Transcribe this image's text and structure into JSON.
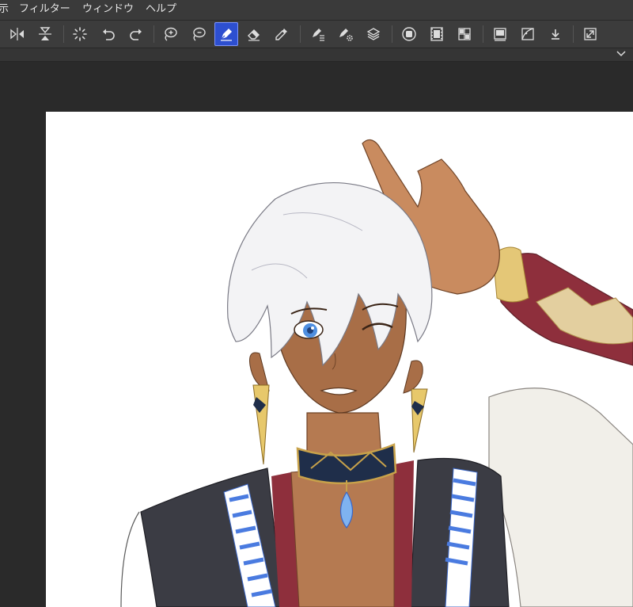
{
  "menu": {
    "items": [
      {
        "label": "示"
      },
      {
        "label": "フィルター"
      },
      {
        "label": "ウィンドウ"
      },
      {
        "label": "ヘルプ"
      }
    ]
  },
  "toolbar": {
    "active_tool": "pen-tool",
    "buttons": [
      {
        "name": "flip-horizontal",
        "icon": "flip-horizontal-icon"
      },
      {
        "name": "flip-vertical",
        "icon": "flip-vertical-icon"
      },
      {
        "name": "loading",
        "icon": "spinner-icon"
      },
      {
        "name": "undo",
        "icon": "undo-icon"
      },
      {
        "name": "redo",
        "icon": "redo-icon"
      },
      {
        "name": "lasso-add",
        "icon": "lasso-add-icon"
      },
      {
        "name": "lasso-subtract",
        "icon": "lasso-subtract-icon"
      },
      {
        "name": "pen-tool",
        "icon": "pen-icon"
      },
      {
        "name": "eraser-tool",
        "icon": "eraser-icon"
      },
      {
        "name": "eyedropper-tool",
        "icon": "eyedropper-icon"
      },
      {
        "name": "pen-settings",
        "icon": "pen-settings-icon"
      },
      {
        "name": "brush-settings",
        "icon": "brush-gear-icon"
      },
      {
        "name": "layers",
        "icon": "layers-icon"
      },
      {
        "name": "stop-record",
        "icon": "stop-icon"
      },
      {
        "name": "timelapse",
        "icon": "film-icon"
      },
      {
        "name": "grid-view",
        "icon": "grid-icon"
      },
      {
        "name": "color-panel",
        "icon": "panel-icon"
      },
      {
        "name": "tone-curve",
        "icon": "curve-icon"
      },
      {
        "name": "download",
        "icon": "download-icon"
      },
      {
        "name": "fullscreen",
        "icon": "expand-icon"
      }
    ]
  },
  "colors": {
    "menubar": "#3a3a3a",
    "toolbar": "#3c3c3c",
    "workspace": "#2a2a2a",
    "active_tool": "#2d4fd0",
    "icon": "#dcdcdc",
    "sketch_yellow": "#f7c548"
  }
}
